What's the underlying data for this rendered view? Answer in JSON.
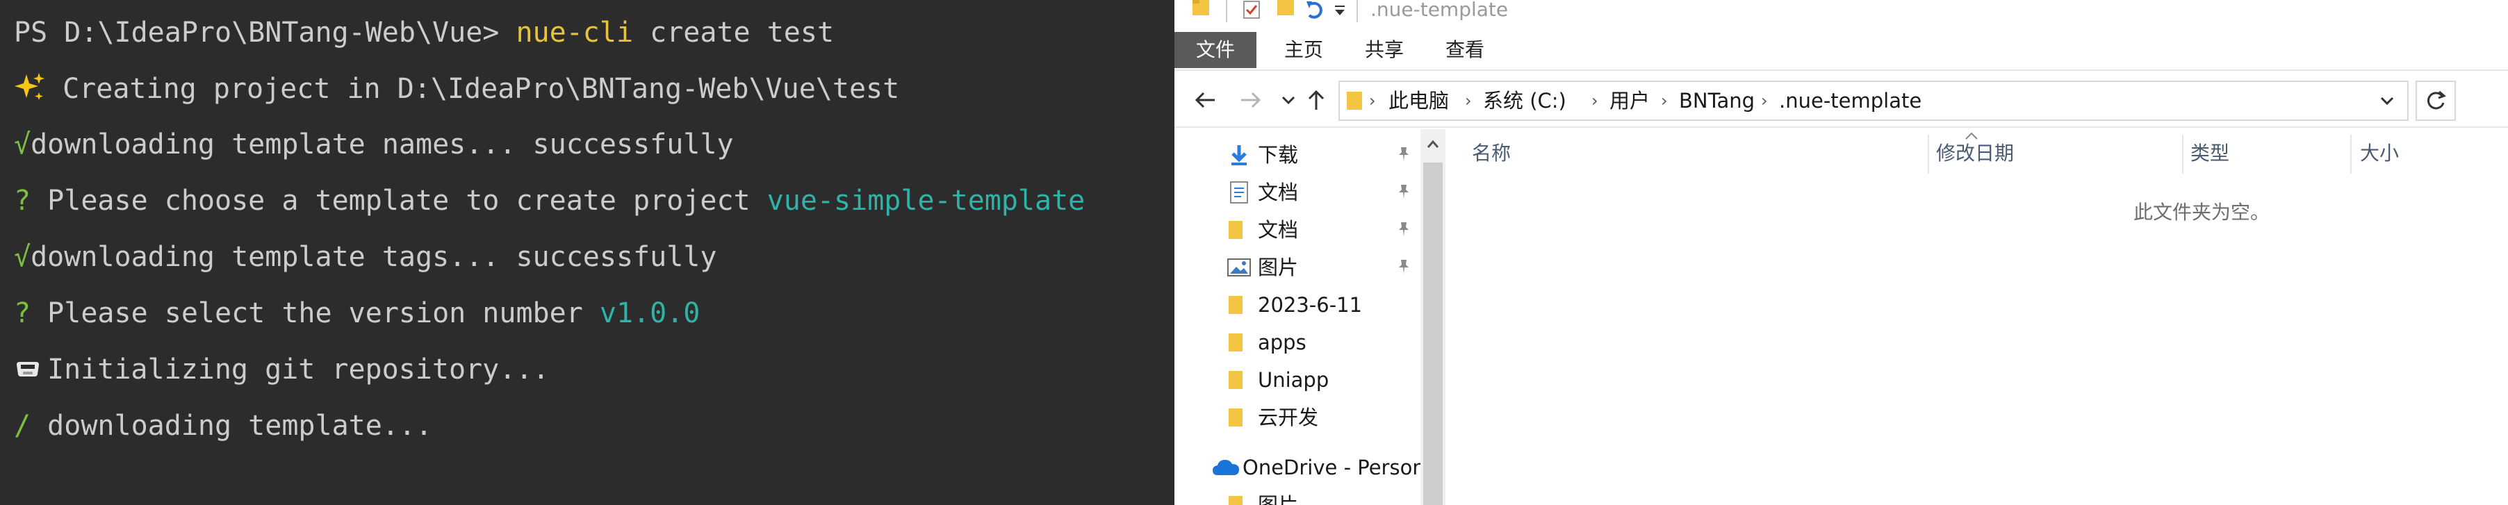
{
  "terminal": {
    "lines": [
      {
        "p1": "PS D:\\IdeaPro\\BNTang-Web\\Vue> ",
        "p2": "nue-cli",
        "p3": " create test"
      },
      {
        "p1": " Creating project in D:\\IdeaPro\\BNTang-Web\\Vue\\test"
      },
      {
        "p1": "√",
        "p2": "downloading template names... successfully"
      },
      {
        "p1": "?",
        "p2": " Please choose a template to create project ",
        "p3": "vue-simple-template"
      },
      {
        "p1": "√",
        "p2": "downloading template tags... successfully"
      },
      {
        "p1": "?",
        "p2": " Please select the version number ",
        "p3": "v1.0.0"
      },
      {
        "p1": "Initializing git repository..."
      },
      {
        "p1": "/",
        "p2": " downloading template..."
      }
    ],
    "colors": {
      "background": "#2c2c2c",
      "text": "#cccccc",
      "command": "#e5c33c",
      "success": "#7fbf3f",
      "highlight": "#2fb3a8"
    }
  },
  "explorer": {
    "title": ".nue-template",
    "ribbon_tabs": [
      "文件",
      "主页",
      "共享",
      "查看"
    ],
    "breadcrumb": [
      "此电脑",
      "系统 (C:)",
      "用户",
      "BNTang",
      ".nue-template"
    ],
    "nav_items": [
      {
        "label": "下载",
        "icon": "download-icon",
        "pinned": true
      },
      {
        "label": "文档",
        "icon": "document-icon",
        "pinned": true
      },
      {
        "label": "文档",
        "icon": "folder-icon",
        "pinned": true
      },
      {
        "label": "图片",
        "icon": "picture-icon",
        "pinned": true
      },
      {
        "label": "2023-6-11",
        "icon": "folder-icon",
        "pinned": false
      },
      {
        "label": "apps",
        "icon": "folder-icon",
        "pinned": false
      },
      {
        "label": "Uniapp",
        "icon": "folder-icon",
        "pinned": false
      },
      {
        "label": "云开发",
        "icon": "folder-icon",
        "pinned": false
      },
      {
        "label": "OneDrive - Persona",
        "icon": "onedrive-cloud-icon",
        "pinned": false
      },
      {
        "label": "图片",
        "icon": "folder-icon",
        "pinned": false
      }
    ],
    "columns": [
      "名称",
      "修改日期",
      "类型",
      "大小"
    ],
    "empty_message": "此文件夹为空。",
    "colors": {
      "accent": "#0078d4",
      "folder": "#f4c542",
      "active_tab": "#5a5a5a"
    }
  }
}
